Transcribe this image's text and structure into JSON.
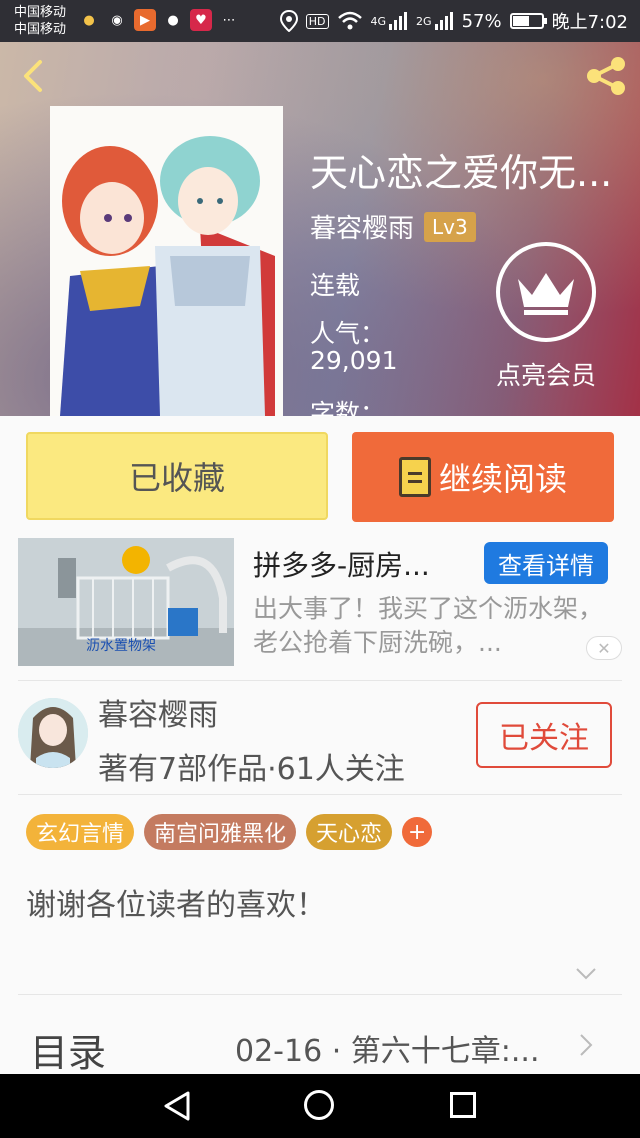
{
  "statusbar": {
    "carrier1": "中国移动",
    "carrier2": "中国移动",
    "network_tags": [
      "HD",
      "4G",
      "2G"
    ],
    "battery_percent": "57%",
    "battery_level": 0.57,
    "time": "晚上7:02"
  },
  "book": {
    "title": "天心恋之爱你无...",
    "author": "暮容樱雨",
    "level": "Lv3",
    "status": "连载",
    "popularity_label": "人气：",
    "popularity_value": "29,091",
    "words_label": "字数："
  },
  "vip": {
    "label": "点亮会员"
  },
  "actions": {
    "collected_label": "已收藏",
    "read_label": "继续阅读"
  },
  "ad": {
    "image_caption": "沥水置物架",
    "title": "拼多多-厨房...",
    "detail_label": "查看详情",
    "description": "出大事了！我买了这个沥水架，老公抢着下厨洗碗，..."
  },
  "author_section": {
    "name": "暮容樱雨",
    "stats": "著有7部作品·61人关注",
    "follow_label": "已关注"
  },
  "tags": [
    {
      "label": "玄幻言情",
      "color": "#f3b33a"
    },
    {
      "label": "南宫问雅黑化",
      "color": "#c47b60"
    },
    {
      "label": "天心恋",
      "color": "#d6a030"
    }
  ],
  "synopsis": "谢谢各位读者的喜欢！",
  "toc": {
    "label": "目录",
    "latest": "02-16 · 第六十七章:..."
  },
  "colors": {
    "accent_orange": "#f06a3a",
    "collected_yellow": "#fbe980",
    "ad_blue": "#1f7ae0",
    "follow_red": "#e04a3a"
  }
}
